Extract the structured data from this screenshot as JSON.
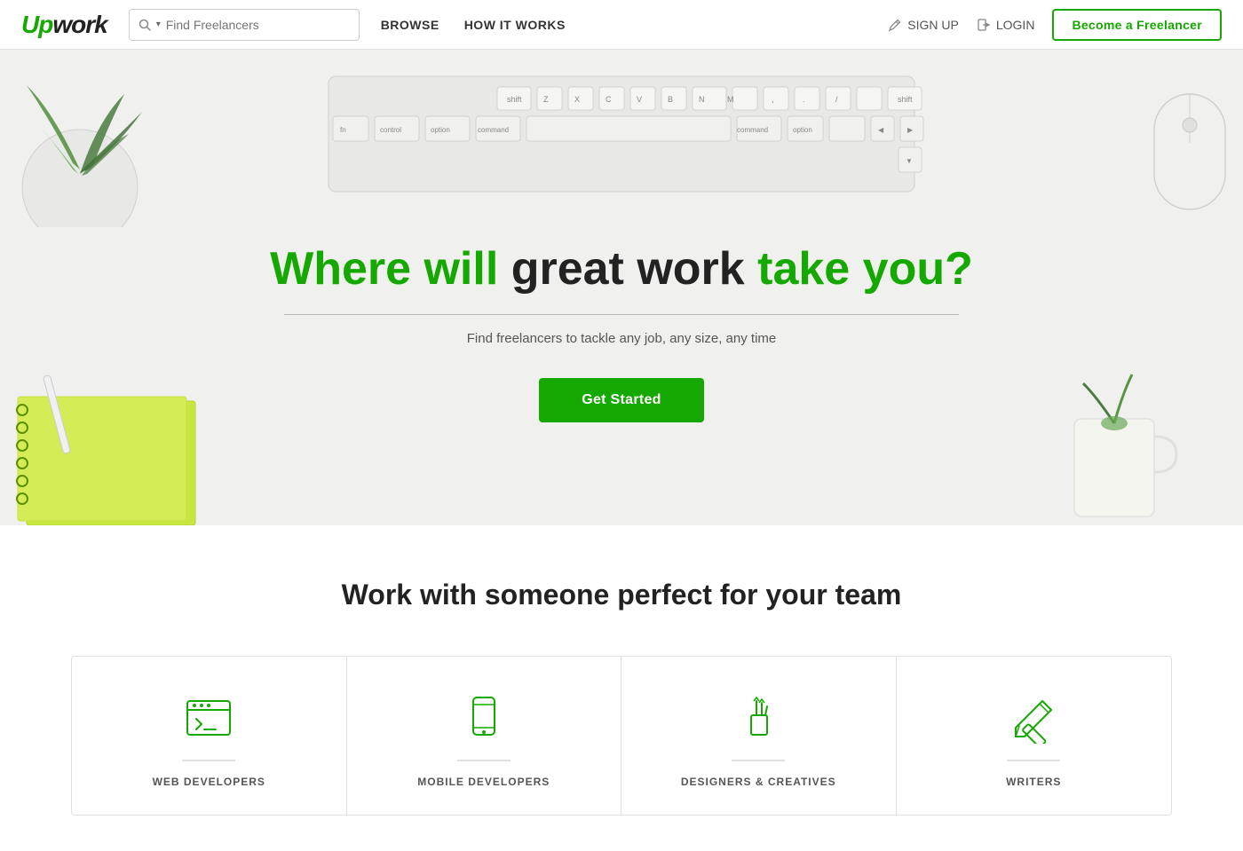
{
  "navbar": {
    "logo": "Upwork",
    "search_placeholder": "Find Freelancers",
    "nav_links": [
      {
        "label": "BROWSE",
        "id": "browse"
      },
      {
        "label": "HOW IT WORKS",
        "id": "how-it-works"
      }
    ],
    "signup_label": "SIGN UP",
    "login_label": "LOGIN",
    "become_label": "Become a Freelancer"
  },
  "hero": {
    "headline_part1": "Where will ",
    "headline_green1": "great work",
    "headline_part2": " take you?",
    "subtitle": "Find freelancers to tackle any job, any size, any time",
    "cta_label": "Get Started"
  },
  "lower": {
    "title": "Work with someone perfect for your team",
    "categories": [
      {
        "id": "web-dev",
        "label": "WEB DEVELOPERS"
      },
      {
        "id": "mobile-dev",
        "label": "MOBILE DEVELOPERS"
      },
      {
        "id": "designers",
        "label": "DESIGNERS & CREATIVES"
      },
      {
        "id": "writers",
        "label": "WRITERS"
      }
    ]
  },
  "colors": {
    "green": "#14a800",
    "dark": "#222222",
    "gray": "#888888"
  }
}
